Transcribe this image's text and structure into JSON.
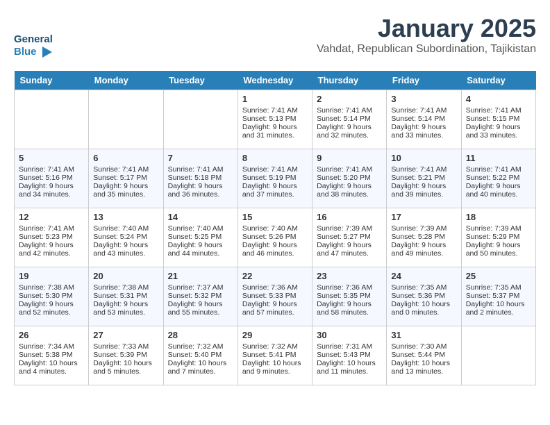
{
  "header": {
    "logo_line1": "General",
    "logo_line2": "Blue",
    "title": "January 2025",
    "subtitle": "Vahdat, Republican Subordination, Tajikistan"
  },
  "columns": [
    "Sunday",
    "Monday",
    "Tuesday",
    "Wednesday",
    "Thursday",
    "Friday",
    "Saturday"
  ],
  "weeks": [
    [
      {
        "day": "",
        "content": ""
      },
      {
        "day": "",
        "content": ""
      },
      {
        "day": "",
        "content": ""
      },
      {
        "day": "1",
        "content": "Sunrise: 7:41 AM\nSunset: 5:13 PM\nDaylight: 9 hours\nand 31 minutes."
      },
      {
        "day": "2",
        "content": "Sunrise: 7:41 AM\nSunset: 5:14 PM\nDaylight: 9 hours\nand 32 minutes."
      },
      {
        "day": "3",
        "content": "Sunrise: 7:41 AM\nSunset: 5:14 PM\nDaylight: 9 hours\nand 33 minutes."
      },
      {
        "day": "4",
        "content": "Sunrise: 7:41 AM\nSunset: 5:15 PM\nDaylight: 9 hours\nand 33 minutes."
      }
    ],
    [
      {
        "day": "5",
        "content": "Sunrise: 7:41 AM\nSunset: 5:16 PM\nDaylight: 9 hours\nand 34 minutes."
      },
      {
        "day": "6",
        "content": "Sunrise: 7:41 AM\nSunset: 5:17 PM\nDaylight: 9 hours\nand 35 minutes."
      },
      {
        "day": "7",
        "content": "Sunrise: 7:41 AM\nSunset: 5:18 PM\nDaylight: 9 hours\nand 36 minutes."
      },
      {
        "day": "8",
        "content": "Sunrise: 7:41 AM\nSunset: 5:19 PM\nDaylight: 9 hours\nand 37 minutes."
      },
      {
        "day": "9",
        "content": "Sunrise: 7:41 AM\nSunset: 5:20 PM\nDaylight: 9 hours\nand 38 minutes."
      },
      {
        "day": "10",
        "content": "Sunrise: 7:41 AM\nSunset: 5:21 PM\nDaylight: 9 hours\nand 39 minutes."
      },
      {
        "day": "11",
        "content": "Sunrise: 7:41 AM\nSunset: 5:22 PM\nDaylight: 9 hours\nand 40 minutes."
      }
    ],
    [
      {
        "day": "12",
        "content": "Sunrise: 7:41 AM\nSunset: 5:23 PM\nDaylight: 9 hours\nand 42 minutes."
      },
      {
        "day": "13",
        "content": "Sunrise: 7:40 AM\nSunset: 5:24 PM\nDaylight: 9 hours\nand 43 minutes."
      },
      {
        "day": "14",
        "content": "Sunrise: 7:40 AM\nSunset: 5:25 PM\nDaylight: 9 hours\nand 44 minutes."
      },
      {
        "day": "15",
        "content": "Sunrise: 7:40 AM\nSunset: 5:26 PM\nDaylight: 9 hours\nand 46 minutes."
      },
      {
        "day": "16",
        "content": "Sunrise: 7:39 AM\nSunset: 5:27 PM\nDaylight: 9 hours\nand 47 minutes."
      },
      {
        "day": "17",
        "content": "Sunrise: 7:39 AM\nSunset: 5:28 PM\nDaylight: 9 hours\nand 49 minutes."
      },
      {
        "day": "18",
        "content": "Sunrise: 7:39 AM\nSunset: 5:29 PM\nDaylight: 9 hours\nand 50 minutes."
      }
    ],
    [
      {
        "day": "19",
        "content": "Sunrise: 7:38 AM\nSunset: 5:30 PM\nDaylight: 9 hours\nand 52 minutes."
      },
      {
        "day": "20",
        "content": "Sunrise: 7:38 AM\nSunset: 5:31 PM\nDaylight: 9 hours\nand 53 minutes."
      },
      {
        "day": "21",
        "content": "Sunrise: 7:37 AM\nSunset: 5:32 PM\nDaylight: 9 hours\nand 55 minutes."
      },
      {
        "day": "22",
        "content": "Sunrise: 7:36 AM\nSunset: 5:33 PM\nDaylight: 9 hours\nand 57 minutes."
      },
      {
        "day": "23",
        "content": "Sunrise: 7:36 AM\nSunset: 5:35 PM\nDaylight: 9 hours\nand 58 minutes."
      },
      {
        "day": "24",
        "content": "Sunrise: 7:35 AM\nSunset: 5:36 PM\nDaylight: 10 hours\nand 0 minutes."
      },
      {
        "day": "25",
        "content": "Sunrise: 7:35 AM\nSunset: 5:37 PM\nDaylight: 10 hours\nand 2 minutes."
      }
    ],
    [
      {
        "day": "26",
        "content": "Sunrise: 7:34 AM\nSunset: 5:38 PM\nDaylight: 10 hours\nand 4 minutes."
      },
      {
        "day": "27",
        "content": "Sunrise: 7:33 AM\nSunset: 5:39 PM\nDaylight: 10 hours\nand 5 minutes."
      },
      {
        "day": "28",
        "content": "Sunrise: 7:32 AM\nSunset: 5:40 PM\nDaylight: 10 hours\nand 7 minutes."
      },
      {
        "day": "29",
        "content": "Sunrise: 7:32 AM\nSunset: 5:41 PM\nDaylight: 10 hours\nand 9 minutes."
      },
      {
        "day": "30",
        "content": "Sunrise: 7:31 AM\nSunset: 5:43 PM\nDaylight: 10 hours\nand 11 minutes."
      },
      {
        "day": "31",
        "content": "Sunrise: 7:30 AM\nSunset: 5:44 PM\nDaylight: 10 hours\nand 13 minutes."
      },
      {
        "day": "",
        "content": ""
      }
    ]
  ]
}
